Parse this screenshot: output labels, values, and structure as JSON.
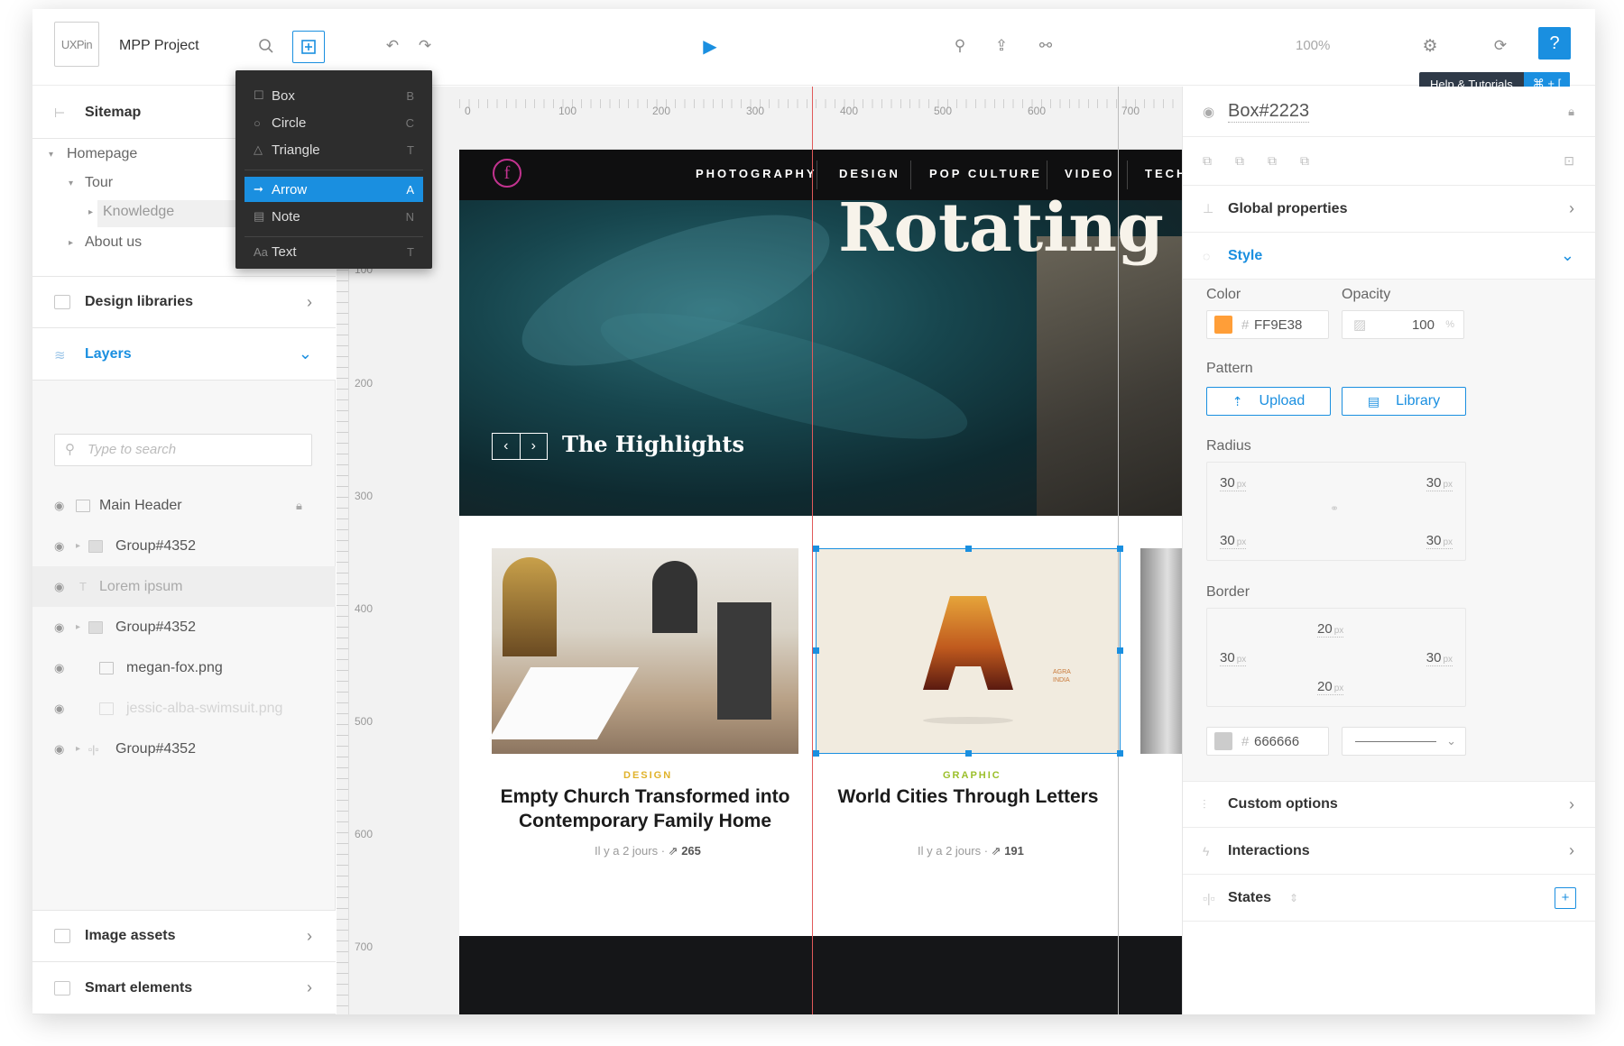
{
  "topbar": {
    "logo": "UXPin",
    "project": "MPP Project",
    "zoom": "100%",
    "help_label": "?",
    "tooltip": {
      "label": "Help & Tutorials",
      "shortcut": "⌘ + ["
    }
  },
  "tools_menu": [
    {
      "label": "Box",
      "key": "B",
      "icon": "square-icon"
    },
    {
      "label": "Circle",
      "key": "C",
      "icon": "circle-icon"
    },
    {
      "label": "Triangle",
      "key": "T",
      "icon": "triangle-icon"
    },
    {
      "label": "Arrow",
      "key": "A",
      "icon": "arrow-icon",
      "selected": true
    },
    {
      "label": "Note",
      "key": "N",
      "icon": "note-icon"
    },
    {
      "label": "Text",
      "key": "T",
      "icon": "text-icon"
    }
  ],
  "sidebar": {
    "sitemap": "Sitemap",
    "tree": {
      "homepage": "Homepage",
      "tour": "Tour",
      "knowledge": "Knowledge",
      "about": "About us"
    },
    "design_libraries": "Design libraries",
    "layers": "Layers",
    "search_placeholder": "Type to search",
    "layer_items": [
      "Main Header",
      "Group#4352",
      "Lorem ipsum",
      "Group#4352",
      "megan-fox.png",
      "jessic-alba-swimsuit.png",
      "Group#4352"
    ],
    "image_assets": "Image assets",
    "smart_elements": "Smart elements"
  },
  "rulers": {
    "h": [
      "0",
      "100",
      "200",
      "300",
      "400",
      "500",
      "600",
      "700"
    ],
    "v": [
      "100",
      "200",
      "300",
      "400",
      "500",
      "600",
      "700"
    ]
  },
  "site": {
    "nav": [
      "PHOTOGRAPHY",
      "DESIGN",
      "POP CULTURE",
      "VIDEO",
      "TECH"
    ],
    "logo": "f",
    "hero_title": "Rotating",
    "highlights": "The Highlights",
    "cards": [
      {
        "category": "DESIGN",
        "category_color": "#e0b22a",
        "title_line1": "Empty Church Transformed into",
        "title_line2": "Contemporary Family Home",
        "time": "Il y a 2 jours",
        "shares": "265"
      },
      {
        "category": "GRAPHIC",
        "category_color": "#9bbf2a",
        "title_line1": "World Cities Through Letters",
        "title_line2": "",
        "time": "Il y a 2 jours",
        "shares": "191",
        "caption_a": "AGRA",
        "caption_b": "INDIA"
      }
    ]
  },
  "inspector": {
    "element_name": "Box#2223",
    "global_properties": "Global properties",
    "style": "Style",
    "color_label": "Color",
    "opacity_label": "Opacity",
    "color_value": "FF9E38",
    "color_swatch": "#FF9E38",
    "opacity_value": "100",
    "opacity_unit": "%",
    "pattern_label": "Pattern",
    "upload": "Upload",
    "library": "Library",
    "radius_label": "Radius",
    "radius": {
      "tl": "30",
      "tr": "30",
      "bl": "30",
      "br": "30",
      "unit": "px"
    },
    "border_label": "Border",
    "border": {
      "top": "20",
      "left": "30",
      "right": "30",
      "bottom": "20",
      "unit": "px"
    },
    "border_color": "666666",
    "border_swatch": "#CCCCCC",
    "custom_options": "Custom options",
    "interactions": "Interactions",
    "states": "States",
    "hash": "#"
  }
}
